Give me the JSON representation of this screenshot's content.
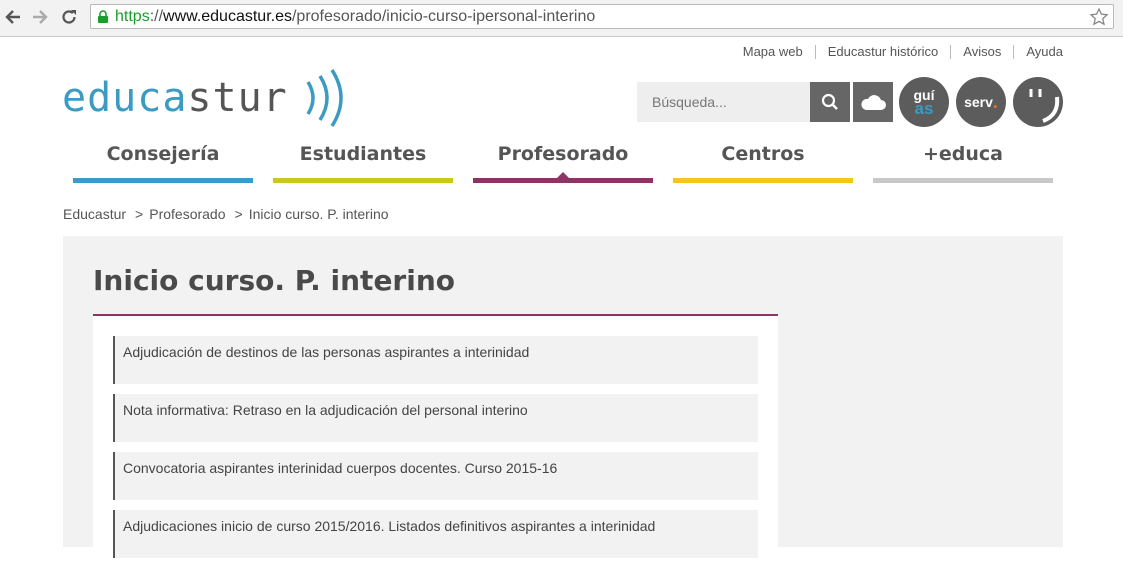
{
  "browser": {
    "url_scheme": "https",
    "url_sep": "://",
    "url_host": "www.educastur.es",
    "url_path": "/profesorado/inicio-curso-ipersonal-interino",
    "icons": [
      "back-icon",
      "forward-icon",
      "reload-icon",
      "lock-icon",
      "star-icon"
    ]
  },
  "toplinks": [
    "Mapa web",
    "Educastur histórico",
    "Avisos",
    "Ayuda"
  ],
  "logo": {
    "part1": "educa",
    "part2": "stur",
    "colors": {
      "part1": "#3b9bc3",
      "part2": "#555555",
      "waves": "#3b9bc3"
    }
  },
  "search": {
    "placeholder": "Búsqueda..."
  },
  "quicklinks": {
    "guias_line1": "guí",
    "guias_line2": "as",
    "serv": "serv",
    "serv_dot": "."
  },
  "mainnav": [
    {
      "label": "Consejería",
      "color": "#3a9dc8"
    },
    {
      "label": "Estudiantes",
      "color": "#c8c81e"
    },
    {
      "label": "Profesorado",
      "color": "#8c3564",
      "active": true
    },
    {
      "label": "Centros",
      "color": "#f2c81c"
    },
    {
      "label": "+educa",
      "color": "#c8c8c8"
    }
  ],
  "breadcrumb": {
    "items": [
      "Educastur",
      "Profesorado",
      "Inicio curso. P. interino"
    ],
    "separator": ">"
  },
  "page": {
    "title": "Inicio curso. P. interino",
    "items": [
      "Adjudicación de destinos de las personas aspirantes a interinidad",
      "Nota informativa: Retraso en la adjudicación del personal interino",
      "Convocatoria aspirantes interinidad cuerpos docentes. Curso 2015-16",
      "Adjudicaciones inicio de curso 2015/2016. Listados definitivos aspirantes a interinidad"
    ]
  }
}
